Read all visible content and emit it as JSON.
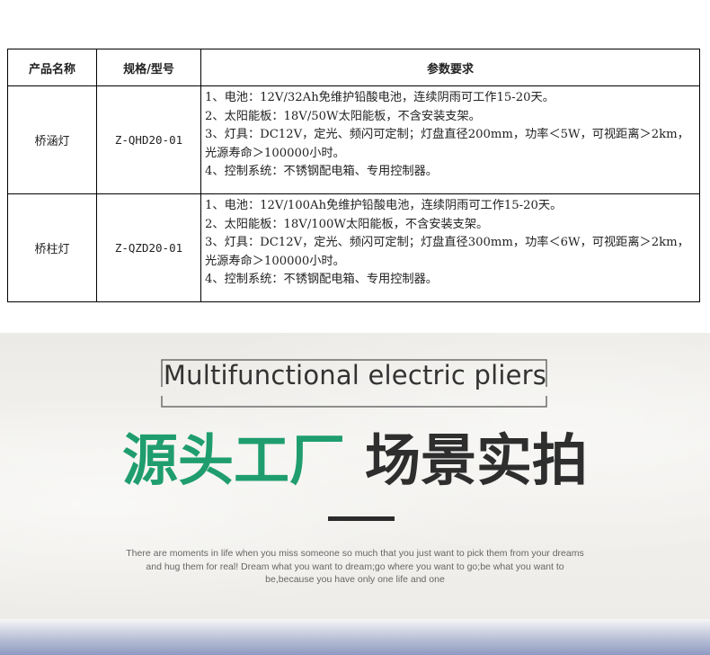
{
  "table": {
    "headers": [
      "产品名称",
      "规格/型号",
      "参数要求"
    ],
    "rows": [
      {
        "name": "桥涵灯",
        "model": "Z-QHD20-01",
        "params": [
          "1、电池：12V/32Ah免维护铅酸电池，连续阴雨可工作15-20天。",
          "2、太阳能板：18V/50W太阳能板，不含安装支架。",
          "3、灯具：DC12V，定光、频闪可定制；灯盘直径200mm，功率＜5W，可视距离＞2km，光源寿命＞100000小时。",
          "4、控制系统：不锈钢配电箱、专用控制器。"
        ]
      },
      {
        "name": "桥柱灯",
        "model": "Z-QZD20-01",
        "params": [
          "1、电池：12V/100Ah免维护铅酸电池，连续阴雨可工作15-20天。",
          "2、太阳能板：18V/100W太阳能板，不含安装支架。",
          "3、灯具：DC12V，定光、频闪可定制；灯盘直径300mm，功率＜6W，可视距离＞2km，光源寿命＞100000小时。",
          "4、控制系统：不锈钢配电箱、专用控制器。"
        ]
      }
    ]
  },
  "banner": {
    "title": "Multifunctional electric pliers",
    "cn_green": "源头工厂",
    "cn_dark": "场景实拍",
    "quote": "There are moments in life when you miss someone so much that you just want to pick them from your dreams and hug them for real! Dream what you want to dream;go where you want to go;be what you want to be,because you have only one life and one"
  },
  "colors": {
    "accent_green": "#1f9d6f",
    "dark_text": "#2e2e2e"
  }
}
